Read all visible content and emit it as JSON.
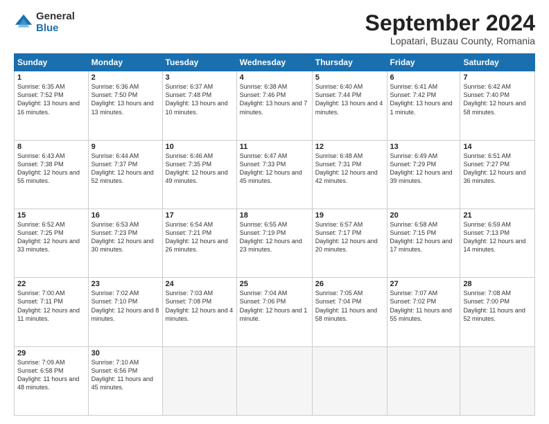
{
  "header": {
    "logo_general": "General",
    "logo_blue": "Blue",
    "month_title": "September 2024",
    "subtitle": "Lopatari, Buzau County, Romania"
  },
  "weekdays": [
    "Sunday",
    "Monday",
    "Tuesday",
    "Wednesday",
    "Thursday",
    "Friday",
    "Saturday"
  ],
  "weeks": [
    [
      {
        "day": "1",
        "sunrise": "Sunrise: 6:35 AM",
        "sunset": "Sunset: 7:52 PM",
        "daylight": "Daylight: 13 hours and 16 minutes."
      },
      {
        "day": "2",
        "sunrise": "Sunrise: 6:36 AM",
        "sunset": "Sunset: 7:50 PM",
        "daylight": "Daylight: 13 hours and 13 minutes."
      },
      {
        "day": "3",
        "sunrise": "Sunrise: 6:37 AM",
        "sunset": "Sunset: 7:48 PM",
        "daylight": "Daylight: 13 hours and 10 minutes."
      },
      {
        "day": "4",
        "sunrise": "Sunrise: 6:38 AM",
        "sunset": "Sunset: 7:46 PM",
        "daylight": "Daylight: 13 hours and 7 minutes."
      },
      {
        "day": "5",
        "sunrise": "Sunrise: 6:40 AM",
        "sunset": "Sunset: 7:44 PM",
        "daylight": "Daylight: 13 hours and 4 minutes."
      },
      {
        "day": "6",
        "sunrise": "Sunrise: 6:41 AM",
        "sunset": "Sunset: 7:42 PM",
        "daylight": "Daylight: 13 hours and 1 minute."
      },
      {
        "day": "7",
        "sunrise": "Sunrise: 6:42 AM",
        "sunset": "Sunset: 7:40 PM",
        "daylight": "Daylight: 12 hours and 58 minutes."
      }
    ],
    [
      {
        "day": "8",
        "sunrise": "Sunrise: 6:43 AM",
        "sunset": "Sunset: 7:38 PM",
        "daylight": "Daylight: 12 hours and 55 minutes."
      },
      {
        "day": "9",
        "sunrise": "Sunrise: 6:44 AM",
        "sunset": "Sunset: 7:37 PM",
        "daylight": "Daylight: 12 hours and 52 minutes."
      },
      {
        "day": "10",
        "sunrise": "Sunrise: 6:46 AM",
        "sunset": "Sunset: 7:35 PM",
        "daylight": "Daylight: 12 hours and 49 minutes."
      },
      {
        "day": "11",
        "sunrise": "Sunrise: 6:47 AM",
        "sunset": "Sunset: 7:33 PM",
        "daylight": "Daylight: 12 hours and 45 minutes."
      },
      {
        "day": "12",
        "sunrise": "Sunrise: 6:48 AM",
        "sunset": "Sunset: 7:31 PM",
        "daylight": "Daylight: 12 hours and 42 minutes."
      },
      {
        "day": "13",
        "sunrise": "Sunrise: 6:49 AM",
        "sunset": "Sunset: 7:29 PM",
        "daylight": "Daylight: 12 hours and 39 minutes."
      },
      {
        "day": "14",
        "sunrise": "Sunrise: 6:51 AM",
        "sunset": "Sunset: 7:27 PM",
        "daylight": "Daylight: 12 hours and 36 minutes."
      }
    ],
    [
      {
        "day": "15",
        "sunrise": "Sunrise: 6:52 AM",
        "sunset": "Sunset: 7:25 PM",
        "daylight": "Daylight: 12 hours and 33 minutes."
      },
      {
        "day": "16",
        "sunrise": "Sunrise: 6:53 AM",
        "sunset": "Sunset: 7:23 PM",
        "daylight": "Daylight: 12 hours and 30 minutes."
      },
      {
        "day": "17",
        "sunrise": "Sunrise: 6:54 AM",
        "sunset": "Sunset: 7:21 PM",
        "daylight": "Daylight: 12 hours and 26 minutes."
      },
      {
        "day": "18",
        "sunrise": "Sunrise: 6:55 AM",
        "sunset": "Sunset: 7:19 PM",
        "daylight": "Daylight: 12 hours and 23 minutes."
      },
      {
        "day": "19",
        "sunrise": "Sunrise: 6:57 AM",
        "sunset": "Sunset: 7:17 PM",
        "daylight": "Daylight: 12 hours and 20 minutes."
      },
      {
        "day": "20",
        "sunrise": "Sunrise: 6:58 AM",
        "sunset": "Sunset: 7:15 PM",
        "daylight": "Daylight: 12 hours and 17 minutes."
      },
      {
        "day": "21",
        "sunrise": "Sunrise: 6:59 AM",
        "sunset": "Sunset: 7:13 PM",
        "daylight": "Daylight: 12 hours and 14 minutes."
      }
    ],
    [
      {
        "day": "22",
        "sunrise": "Sunrise: 7:00 AM",
        "sunset": "Sunset: 7:11 PM",
        "daylight": "Daylight: 12 hours and 11 minutes."
      },
      {
        "day": "23",
        "sunrise": "Sunrise: 7:02 AM",
        "sunset": "Sunset: 7:10 PM",
        "daylight": "Daylight: 12 hours and 8 minutes."
      },
      {
        "day": "24",
        "sunrise": "Sunrise: 7:03 AM",
        "sunset": "Sunset: 7:08 PM",
        "daylight": "Daylight: 12 hours and 4 minutes."
      },
      {
        "day": "25",
        "sunrise": "Sunrise: 7:04 AM",
        "sunset": "Sunset: 7:06 PM",
        "daylight": "Daylight: 12 hours and 1 minute."
      },
      {
        "day": "26",
        "sunrise": "Sunrise: 7:05 AM",
        "sunset": "Sunset: 7:04 PM",
        "daylight": "Daylight: 11 hours and 58 minutes."
      },
      {
        "day": "27",
        "sunrise": "Sunrise: 7:07 AM",
        "sunset": "Sunset: 7:02 PM",
        "daylight": "Daylight: 11 hours and 55 minutes."
      },
      {
        "day": "28",
        "sunrise": "Sunrise: 7:08 AM",
        "sunset": "Sunset: 7:00 PM",
        "daylight": "Daylight: 11 hours and 52 minutes."
      }
    ],
    [
      {
        "day": "29",
        "sunrise": "Sunrise: 7:09 AM",
        "sunset": "Sunset: 6:58 PM",
        "daylight": "Daylight: 11 hours and 48 minutes."
      },
      {
        "day": "30",
        "sunrise": "Sunrise: 7:10 AM",
        "sunset": "Sunset: 6:56 PM",
        "daylight": "Daylight: 11 hours and 45 minutes."
      },
      null,
      null,
      null,
      null,
      null
    ]
  ]
}
